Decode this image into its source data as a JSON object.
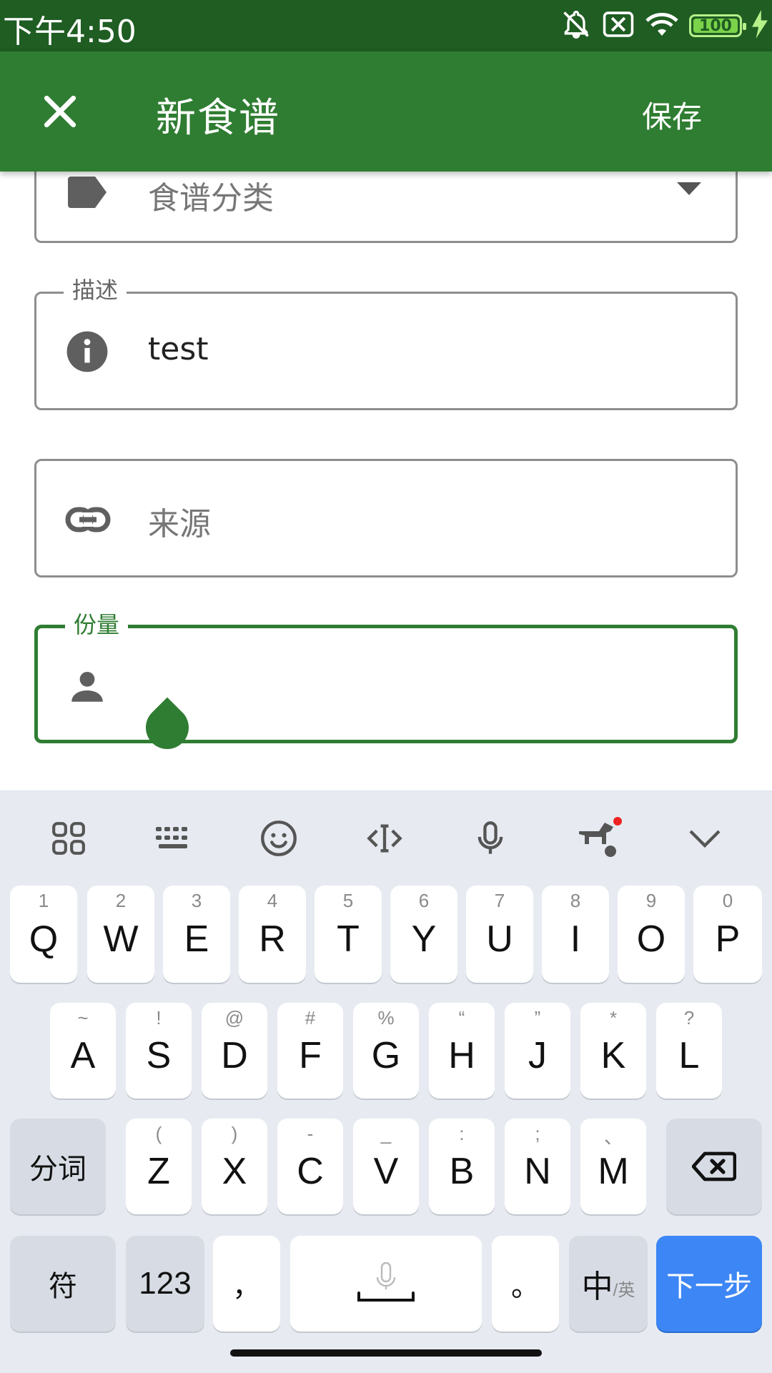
{
  "status_bar": {
    "time": "下午4:50",
    "battery": "100",
    "icons": [
      "bell-off-icon",
      "sim-off-icon",
      "wifi-icon",
      "battery-icon",
      "charging-icon"
    ]
  },
  "app_bar": {
    "title": "新食谱",
    "save_label": "保存",
    "close_icon": "close-icon",
    "background": "#2f7d32"
  },
  "form": {
    "category": {
      "placeholder": "食谱分类",
      "icon": "label-icon",
      "dropdown_icon": "arrow-drop-down-icon"
    },
    "description": {
      "label": "描述",
      "value": "test",
      "icon": "info-icon"
    },
    "source": {
      "placeholder": "来源",
      "icon": "link-icon"
    },
    "servings": {
      "label": "份量",
      "value": "",
      "icon": "person-icon",
      "focused": true
    }
  },
  "keyboard": {
    "toolbar_icons": [
      "apps-grid-icon",
      "keyboard-icon",
      "emoji-icon",
      "text-cursor-icon",
      "microphone-icon",
      "guide-dog-icon",
      "collapse-chevron-icon"
    ],
    "row1": [
      {
        "k": "Q",
        "h": "1"
      },
      {
        "k": "W",
        "h": "2"
      },
      {
        "k": "E",
        "h": "3"
      },
      {
        "k": "R",
        "h": "4"
      },
      {
        "k": "T",
        "h": "5"
      },
      {
        "k": "Y",
        "h": "6"
      },
      {
        "k": "U",
        "h": "7"
      },
      {
        "k": "I",
        "h": "8"
      },
      {
        "k": "O",
        "h": "9"
      },
      {
        "k": "P",
        "h": "0"
      }
    ],
    "row2": [
      {
        "k": "A",
        "h": "~"
      },
      {
        "k": "S",
        "h": "!"
      },
      {
        "k": "D",
        "h": "@"
      },
      {
        "k": "F",
        "h": "#"
      },
      {
        "k": "G",
        "h": "%"
      },
      {
        "k": "H",
        "h": "“"
      },
      {
        "k": "J",
        "h": "”"
      },
      {
        "k": "K",
        "h": "*"
      },
      {
        "k": "L",
        "h": "?"
      }
    ],
    "row3": [
      {
        "k": "Z",
        "h": "("
      },
      {
        "k": "X",
        "h": ")"
      },
      {
        "k": "C",
        "h": "-"
      },
      {
        "k": "V",
        "h": "_"
      },
      {
        "k": "B",
        "h": ":"
      },
      {
        "k": "N",
        "h": ";"
      },
      {
        "k": "M",
        "h": "、"
      }
    ],
    "segment_label": "分词",
    "symbols_label": "符",
    "numbers_label": "123",
    "comma_label": "，",
    "period_label": "。",
    "lang_label": "中",
    "lang_alt_label": "/英",
    "next_label": "下一步",
    "accent": "#3d86f5"
  }
}
